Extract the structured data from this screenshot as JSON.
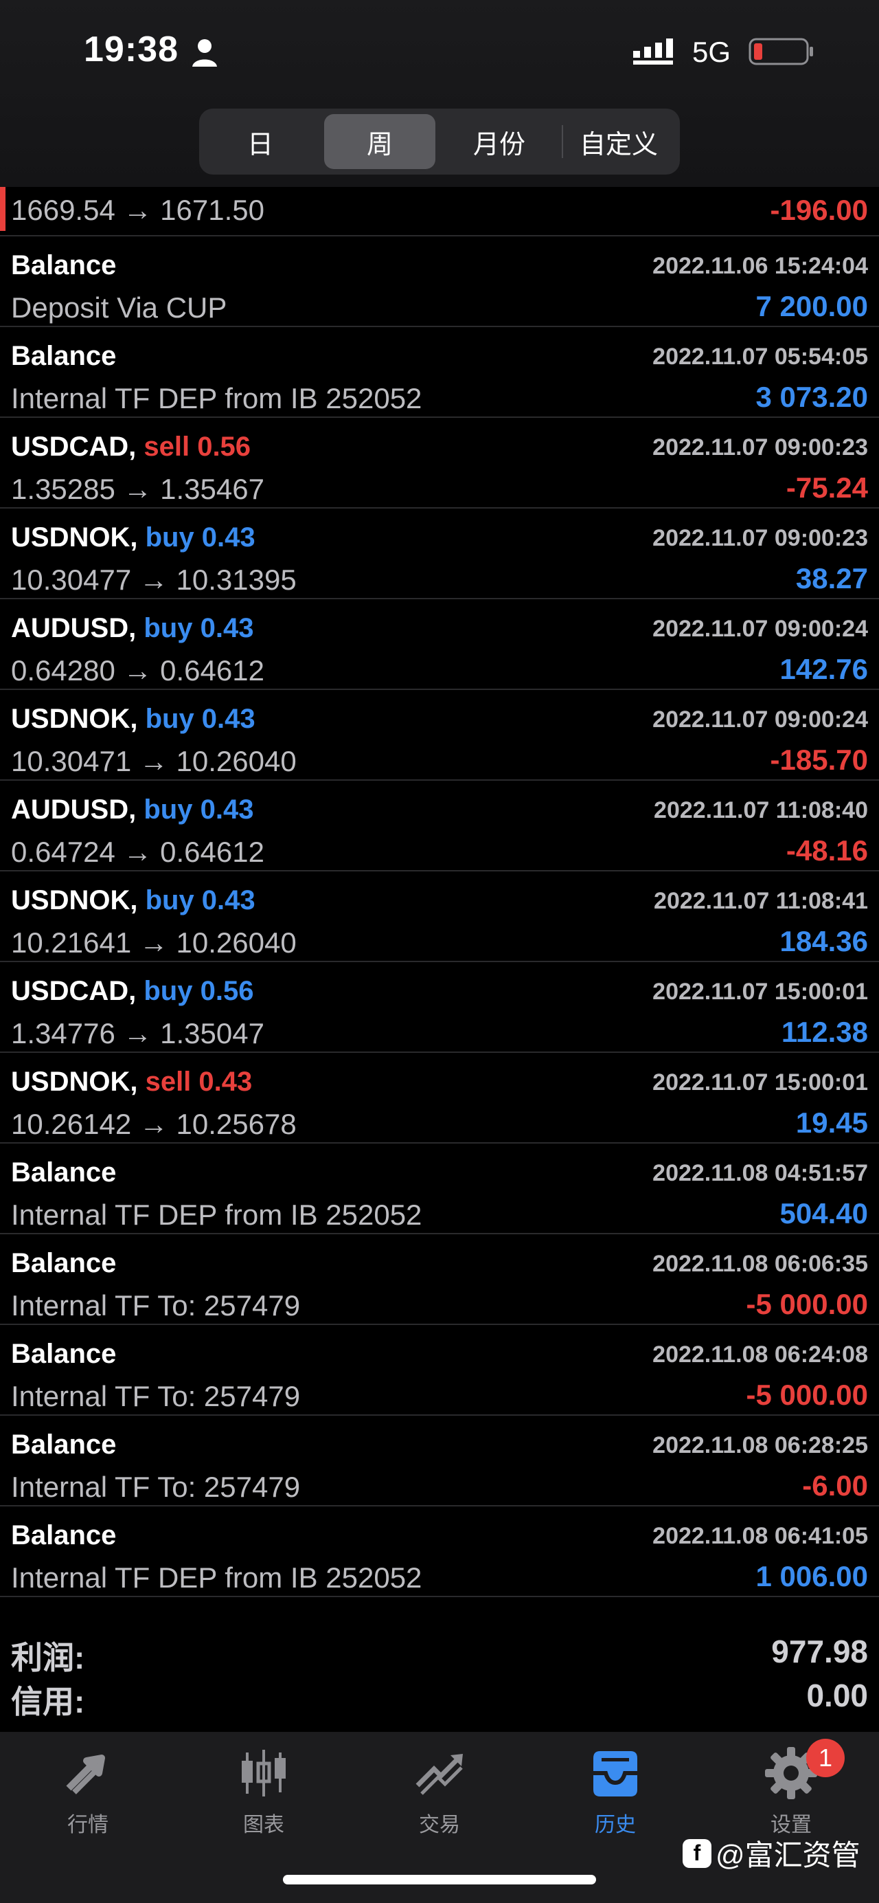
{
  "status": {
    "time": "19:38",
    "network": "5G"
  },
  "segments": [
    "日",
    "周",
    "月份",
    "自定义"
  ],
  "active_segment": "周",
  "first_row": {
    "desc": "1669.54 → 1671.50",
    "amount": "-196.00",
    "sign": "neg"
  },
  "rows": [
    {
      "symbol": "Balance",
      "side": "",
      "side_type": "",
      "time": "2022.11.06 15:24:04",
      "desc": "Deposit Via CUP",
      "amount": "7 200.00",
      "sign": "pos"
    },
    {
      "symbol": "Balance",
      "side": "",
      "side_type": "",
      "time": "2022.11.07 05:54:05",
      "desc": "Internal TF DEP from IB 252052",
      "amount": "3 073.20",
      "sign": "pos"
    },
    {
      "symbol": "USDCAD,",
      "side": "sell 0.56",
      "side_type": "sell",
      "time": "2022.11.07 09:00:23",
      "desc": "1.35285 → 1.35467",
      "amount": "-75.24",
      "sign": "neg"
    },
    {
      "symbol": "USDNOK,",
      "side": "buy 0.43",
      "side_type": "buy",
      "time": "2022.11.07 09:00:23",
      "desc": "10.30477 → 10.31395",
      "amount": "38.27",
      "sign": "pos"
    },
    {
      "symbol": "AUDUSD,",
      "side": "buy 0.43",
      "side_type": "buy",
      "time": "2022.11.07 09:00:24",
      "desc": "0.64280 → 0.64612",
      "amount": "142.76",
      "sign": "pos"
    },
    {
      "symbol": "USDNOK,",
      "side": "buy 0.43",
      "side_type": "buy",
      "time": "2022.11.07 09:00:24",
      "desc": "10.30471 → 10.26040",
      "amount": "-185.70",
      "sign": "neg"
    },
    {
      "symbol": "AUDUSD,",
      "side": "buy 0.43",
      "side_type": "buy",
      "time": "2022.11.07 11:08:40",
      "desc": "0.64724 → 0.64612",
      "amount": "-48.16",
      "sign": "neg"
    },
    {
      "symbol": "USDNOK,",
      "side": "buy 0.43",
      "side_type": "buy",
      "time": "2022.11.07 11:08:41",
      "desc": "10.21641 → 10.26040",
      "amount": "184.36",
      "sign": "pos"
    },
    {
      "symbol": "USDCAD,",
      "side": "buy 0.56",
      "side_type": "buy",
      "time": "2022.11.07 15:00:01",
      "desc": "1.34776 → 1.35047",
      "amount": "112.38",
      "sign": "pos"
    },
    {
      "symbol": "USDNOK,",
      "side": "sell 0.43",
      "side_type": "sell",
      "time": "2022.11.07 15:00:01",
      "desc": "10.26142 → 10.25678",
      "amount": "19.45",
      "sign": "pos"
    },
    {
      "symbol": "Balance",
      "side": "",
      "side_type": "",
      "time": "2022.11.08 04:51:57",
      "desc": "Internal TF DEP from IB 252052",
      "amount": "504.40",
      "sign": "pos"
    },
    {
      "symbol": "Balance",
      "side": "",
      "side_type": "",
      "time": "2022.11.08 06:06:35",
      "desc": "Internal TF To: 257479",
      "amount": "-5 000.00",
      "sign": "neg"
    },
    {
      "symbol": "Balance",
      "side": "",
      "side_type": "",
      "time": "2022.11.08 06:24:08",
      "desc": "Internal TF To: 257479",
      "amount": "-5 000.00",
      "sign": "neg"
    },
    {
      "symbol": "Balance",
      "side": "",
      "side_type": "",
      "time": "2022.11.08 06:28:25",
      "desc": "Internal TF To: 257479",
      "amount": "-6.00",
      "sign": "neg"
    },
    {
      "symbol": "Balance",
      "side": "",
      "side_type": "",
      "time": "2022.11.08 06:41:05",
      "desc": "Internal TF DEP from IB 252052",
      "amount": "1 006.00",
      "sign": "pos"
    }
  ],
  "summary": [
    {
      "label": "利润:",
      "value": "977.98"
    },
    {
      "label": "信用:",
      "value": "0.00"
    }
  ],
  "tabs": [
    {
      "label": "行情",
      "icon": "quotes-icon",
      "active": false
    },
    {
      "label": "图表",
      "icon": "chart-icon",
      "active": false
    },
    {
      "label": "交易",
      "icon": "trade-icon",
      "active": false
    },
    {
      "label": "历史",
      "icon": "history-icon",
      "active": true
    },
    {
      "label": "设置",
      "icon": "gear-icon",
      "active": false
    }
  ],
  "settings_badge": "1",
  "watermark": "@富汇资管",
  "watermark_logo": "f",
  "colors": {
    "positive": "#3a8cf0",
    "negative": "#e8403c",
    "background": "#000000"
  }
}
